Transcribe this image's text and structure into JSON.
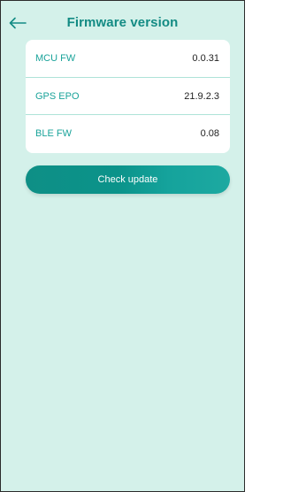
{
  "header": {
    "title": "Firmware version"
  },
  "firmware": {
    "items": [
      {
        "label": "MCU FW",
        "value": "0.0.31"
      },
      {
        "label": "GPS EPO",
        "value": "21.9.2.3"
      },
      {
        "label": "BLE FW",
        "value": "0.08"
      }
    ]
  },
  "actions": {
    "check_update_label": "Check update"
  },
  "colors": {
    "background": "#d4f1ea",
    "accent": "#138b84",
    "label": "#1aa39a",
    "card": "#ffffff"
  }
}
